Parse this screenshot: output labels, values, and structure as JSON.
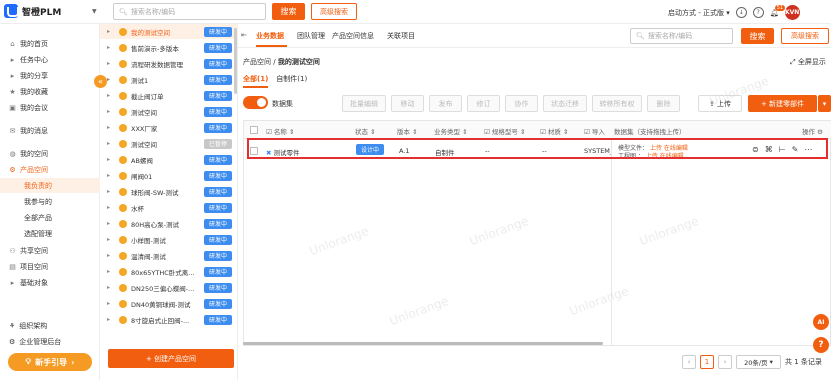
{
  "app": {
    "name": "智橙PLM"
  },
  "topbar": {
    "search_placeholder": "搜索名称/编码",
    "search_button": "搜索",
    "advanced_button": "高级搜索",
    "launch_mode": "启动方式 - 正式版",
    "notification_count": "51",
    "avatar_text": "KVN"
  },
  "sidebar": {
    "items": [
      {
        "label": "我的首页",
        "icon": "home-icon"
      },
      {
        "label": "任务中心",
        "icon": "task-icon"
      },
      {
        "label": "我的分享",
        "icon": "share-icon"
      },
      {
        "label": "我的收藏",
        "icon": "star-icon"
      },
      {
        "label": "我的会议",
        "icon": "meeting-icon"
      },
      {
        "label": "我的消息",
        "icon": "message-icon"
      },
      {
        "label": "我的空间",
        "icon": "space-icon"
      },
      {
        "label": "产品空间",
        "icon": "product-icon"
      }
    ],
    "sub_items": [
      "我负责的",
      "我参与的",
      "全部产品",
      "选配管理"
    ],
    "lower_items": [
      {
        "label": "共享空间",
        "icon": "shared-icon"
      },
      {
        "label": "项目空间",
        "icon": "project-icon"
      },
      {
        "label": "基础对象",
        "icon": "object-icon"
      }
    ],
    "footer": [
      {
        "label": "组织架构",
        "icon": "org-icon"
      },
      {
        "label": "企业管理后台",
        "icon": "admin-icon"
      }
    ],
    "guide_button": "新手引导"
  },
  "tree": {
    "items": [
      {
        "label": "我的测试空间",
        "badge": "研发中"
      },
      {
        "label": "售前演示-多版本",
        "badge": "研发中"
      },
      {
        "label": "流程研发数据管理",
        "badge": "研发中"
      },
      {
        "label": "测试1",
        "badge": "研发中"
      },
      {
        "label": "截止阀订单",
        "badge": "研发中"
      },
      {
        "label": "测试空间",
        "badge": "研发中"
      },
      {
        "label": "XXX厂家",
        "badge": "研发中"
      },
      {
        "label": "测试空间",
        "badge": "已暂停"
      },
      {
        "label": "AB螺阀",
        "badge": "研发中"
      },
      {
        "label": "闸阀01",
        "badge": "研发中"
      },
      {
        "label": "球形阀-SW-测试",
        "badge": "研发中"
      },
      {
        "label": "水杯",
        "badge": "研发中"
      },
      {
        "label": "80H高心泵-测试",
        "badge": "研发中"
      },
      {
        "label": "小样图-测试",
        "badge": "研发中"
      },
      {
        "label": "温清阀-测试",
        "badge": "研发中"
      },
      {
        "label": "80x65YTHC卧式离...",
        "badge": "研发中"
      },
      {
        "label": "DN250三偏心蝶阀-...",
        "badge": "研发中"
      },
      {
        "label": "DN40黄铜球阀-测试",
        "badge": "研发中"
      },
      {
        "label": "8寸旋启式止回阀-...",
        "badge": "研发中"
      }
    ],
    "create_button": "+ 创建产品空间"
  },
  "main": {
    "tabs": [
      "业务数据",
      "团队管理",
      "产品空间信息",
      "关联项目"
    ],
    "search_placeholder": "搜索名称/编码",
    "search_button": "搜索",
    "advanced_button": "高级搜索",
    "breadcrumb_root": "产品空间",
    "breadcrumb_sep": "/",
    "breadcrumb_current": "我的测试空间",
    "fullscreen": "全屏显示",
    "subtabs": [
      "全部(1)",
      "自制件(1)"
    ],
    "dataset_label": "数据集",
    "toolbar_buttons": [
      "批量编辑",
      "移动",
      "发布",
      "修订",
      "协作",
      "状态迁移",
      "转移所有权",
      "删除"
    ],
    "upload_button": "上传",
    "new_part_button": "+ 新建零部件",
    "table": {
      "columns": [
        "名称",
        "状态",
        "版本",
        "业务类型",
        "规格型号",
        "材质",
        "导入",
        "数据集（支持拖拽上传）",
        "操作"
      ],
      "rows": [
        {
          "name": "测试零件",
          "status": "设计中",
          "version": "A.1",
          "type": "自制件",
          "spec": "--",
          "material": "--",
          "import": "SYSTEM_",
          "model_label": "模型文件：",
          "model_upload": "上传",
          "model_edit": "在线编辑",
          "drawing_label": "工程图 ：",
          "drawing_upload": "上传",
          "drawing_edit": "在线编辑"
        }
      ]
    },
    "pagination": {
      "page": "1",
      "page_size": "20条/页",
      "total": "共 1 条记录"
    }
  },
  "watermark": "Unlorange",
  "colors": {
    "accent": "#f25e0f",
    "badge_blue": "#3d8cf0",
    "highlight": "#e52e2e"
  }
}
